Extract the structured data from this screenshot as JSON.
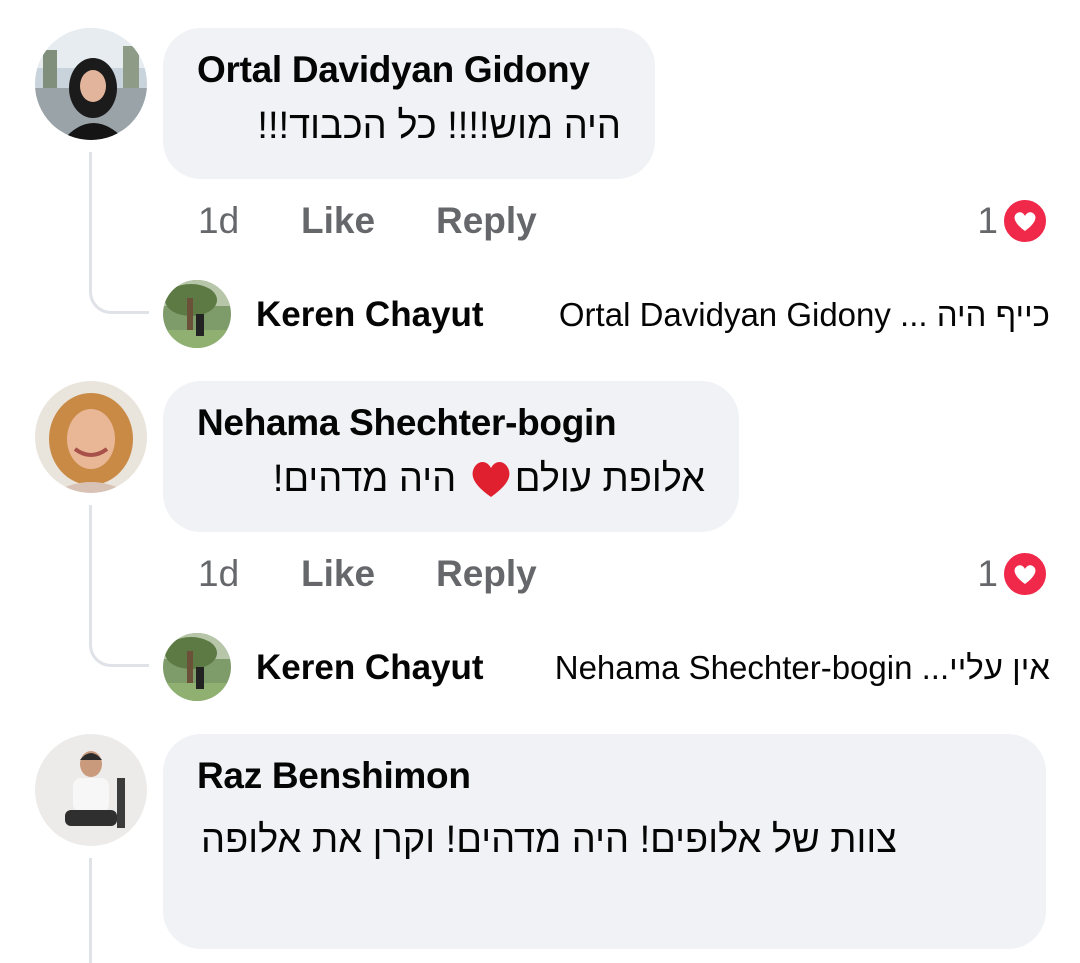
{
  "comments": [
    {
      "author": "Ortal Davidyan Gidony",
      "text": "היה מוש!!!! כל הכבוד!!!",
      "time": "1d",
      "like_label": "Like",
      "reply_label": "Reply",
      "reaction_count": "1",
      "reaction_icon": "love-reaction-icon",
      "reply_preview": {
        "author": "Keren Chayut",
        "text": "Ortal Davidyan Gidony ... כייף היה"
      }
    },
    {
      "author": "Nehama Shechter-bogin",
      "text_before_emoji": "אלופת עולם",
      "emoji": "red-heart-emoji",
      "text_after_emoji": " היה מדהים!",
      "time": "1d",
      "like_label": "Like",
      "reply_label": "Reply",
      "reaction_count": "1",
      "reaction_icon": "love-reaction-icon",
      "reply_preview": {
        "author": "Keren Chayut",
        "text": "Nehama Shechter-bogin ...אין עליי"
      }
    },
    {
      "author": "Raz Benshimon",
      "text": "צוות של אלופים! היה מדהים! וקרן את אלופה"
    }
  ],
  "colors": {
    "bubble_bg": "#f0f2f5",
    "secondary_text": "#65676b",
    "primary_text": "#050505",
    "love_reaction": "#f0284a",
    "thread_line": "#dfe2e6"
  }
}
